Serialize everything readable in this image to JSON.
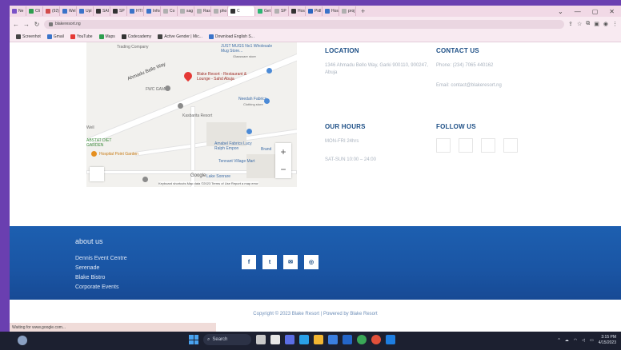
{
  "browser": {
    "tabs": [
      {
        "label": "Ne",
        "color": "#7a52c7"
      },
      {
        "label": "Cli",
        "color": "#2e9e4f"
      },
      {
        "label": "(92)",
        "color": "#d14b4b"
      },
      {
        "label": "Wel",
        "color": "#3a73c9"
      },
      {
        "label": "Upl",
        "color": "#3a73c9"
      },
      {
        "label": "SAI",
        "color": "#333333"
      },
      {
        "label": "SP",
        "color": "#333333"
      },
      {
        "label": "HTI",
        "color": "#3a73c9"
      },
      {
        "label": "Infor",
        "color": "#3a73c9"
      },
      {
        "label": "Co",
        "color": "#b0b0b0"
      },
      {
        "label": "sag",
        "color": "#b0b0b0"
      },
      {
        "label": "Ras",
        "color": "#b0b0b0"
      },
      {
        "label": "pho",
        "color": "#b0b0b0"
      },
      {
        "label": "C",
        "color": "#333333",
        "active": true
      },
      {
        "label": "Get",
        "color": "#2bb673"
      },
      {
        "label": "SP",
        "color": "#b0b0b0"
      },
      {
        "label": "Hos",
        "color": "#333333"
      },
      {
        "label": "Pidl",
        "color": "#2b66c0"
      },
      {
        "label": "Hos",
        "color": "#3a73c9"
      },
      {
        "label": "proj",
        "color": "#b0b0b0"
      }
    ],
    "new_tab": "+",
    "window_controls": [
      "⌄",
      "—",
      "▢",
      "✕"
    ],
    "url": "blakeresort.ng",
    "bookmarks": [
      {
        "label": "Screenhot",
        "color": "#444444"
      },
      {
        "label": "Gmail",
        "color": "#3a73c9"
      },
      {
        "label": "YouTube",
        "color": "#e53935"
      },
      {
        "label": "Maps",
        "color": "#2e9e4f"
      },
      {
        "label": "Codecademy",
        "color": "#333333"
      },
      {
        "label": "Active Gender | Mic...",
        "color": "#444444"
      },
      {
        "label": "Download English S...",
        "color": "#3a73c9"
      }
    ]
  },
  "map": {
    "labels": {
      "trading": "Trading Company",
      "road": "Ahmadu Bello Way",
      "mug": "JUST MUGS No1 Wholesale Mug Store...",
      "mug_sub": "Glassware store",
      "resort": "Blake Resort - Restaurant & Lounge - Sahd Abuja",
      "fwc": "FWC GAMKI",
      "needah": "Needah Fabrics",
      "needah_sub": "Clothing store",
      "kasbarita": "Kasbarita Resort",
      "well": "Well",
      "abstat": "ABSTAT DIET GARDEN",
      "amabel": "Amabel Fabrics Lucy Ralph Empon",
      "brandy": "Brand",
      "tennant": "Tennant Village Mart",
      "hospital": "Hospital Point Garden",
      "lake": "Lake Sonrare",
      "google": "Google",
      "footer": "Keyboard shortcuts   Map data ©2023   Terms of Use   Report a map error"
    },
    "zoom_in": "+",
    "zoom_out": "−"
  },
  "location": {
    "heading": "LOCATION",
    "text": "1346 Ahmadu Bello Way, Garki 900110, 900247, Abuja"
  },
  "contact": {
    "heading": "CONTACT US",
    "phone": "Phone: (234) 7065 440162",
    "email": "Email: contact@blakeresort.ng"
  },
  "hours": {
    "heading": "OUR HOURS",
    "weekdays": "MON-FRI 24hrs",
    "weekend": "SAT-SUN 10:00 – 24:00"
  },
  "follow": {
    "heading": "FOLLOW US"
  },
  "footer": {
    "heading": "about us",
    "links": [
      "Dennis Event Centre",
      "Serenade",
      "Blake Bistro",
      "Corporate Events"
    ],
    "icons": [
      "f",
      "t",
      "✉",
      "◎"
    ]
  },
  "copyright": "Copyright © 2023 Blake Resort | Powered by Blake Resort",
  "status_text": "Waiting for www.google.com...",
  "taskbar": {
    "search": "Search",
    "time": "3:15 PM",
    "date": "4/15/2023"
  }
}
